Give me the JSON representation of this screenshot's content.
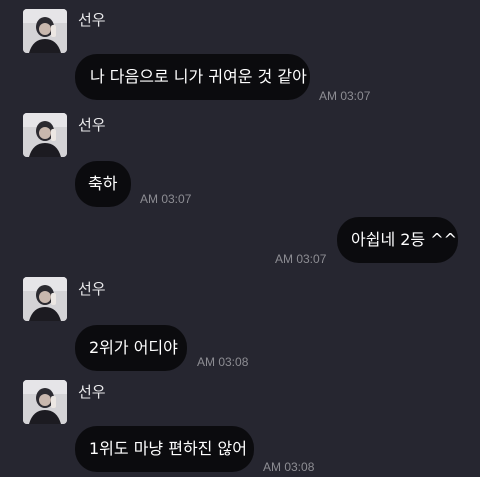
{
  "chat": {
    "messages": [
      {
        "sender": "선우",
        "text": "나 다음으로 니가 귀여운 것 같아",
        "time": "AM 03:07"
      },
      {
        "sender": "선우",
        "text": "축하",
        "time": "AM 03:07"
      },
      {
        "text": "아쉽네 2등 ^^",
        "time": "AM 03:07"
      },
      {
        "sender": "선우",
        "text": "2위가 어디야",
        "time": "AM 03:08"
      },
      {
        "sender": "선우",
        "text": "1위도 마냥 편하진 않어",
        "time": "AM 03:08"
      }
    ]
  },
  "colors": {
    "background": "#262630",
    "bubble": "#0b0b0e",
    "bubble_text": "#ffffff",
    "timestamp": "#8d8d93",
    "name": "#e8e8ea"
  }
}
